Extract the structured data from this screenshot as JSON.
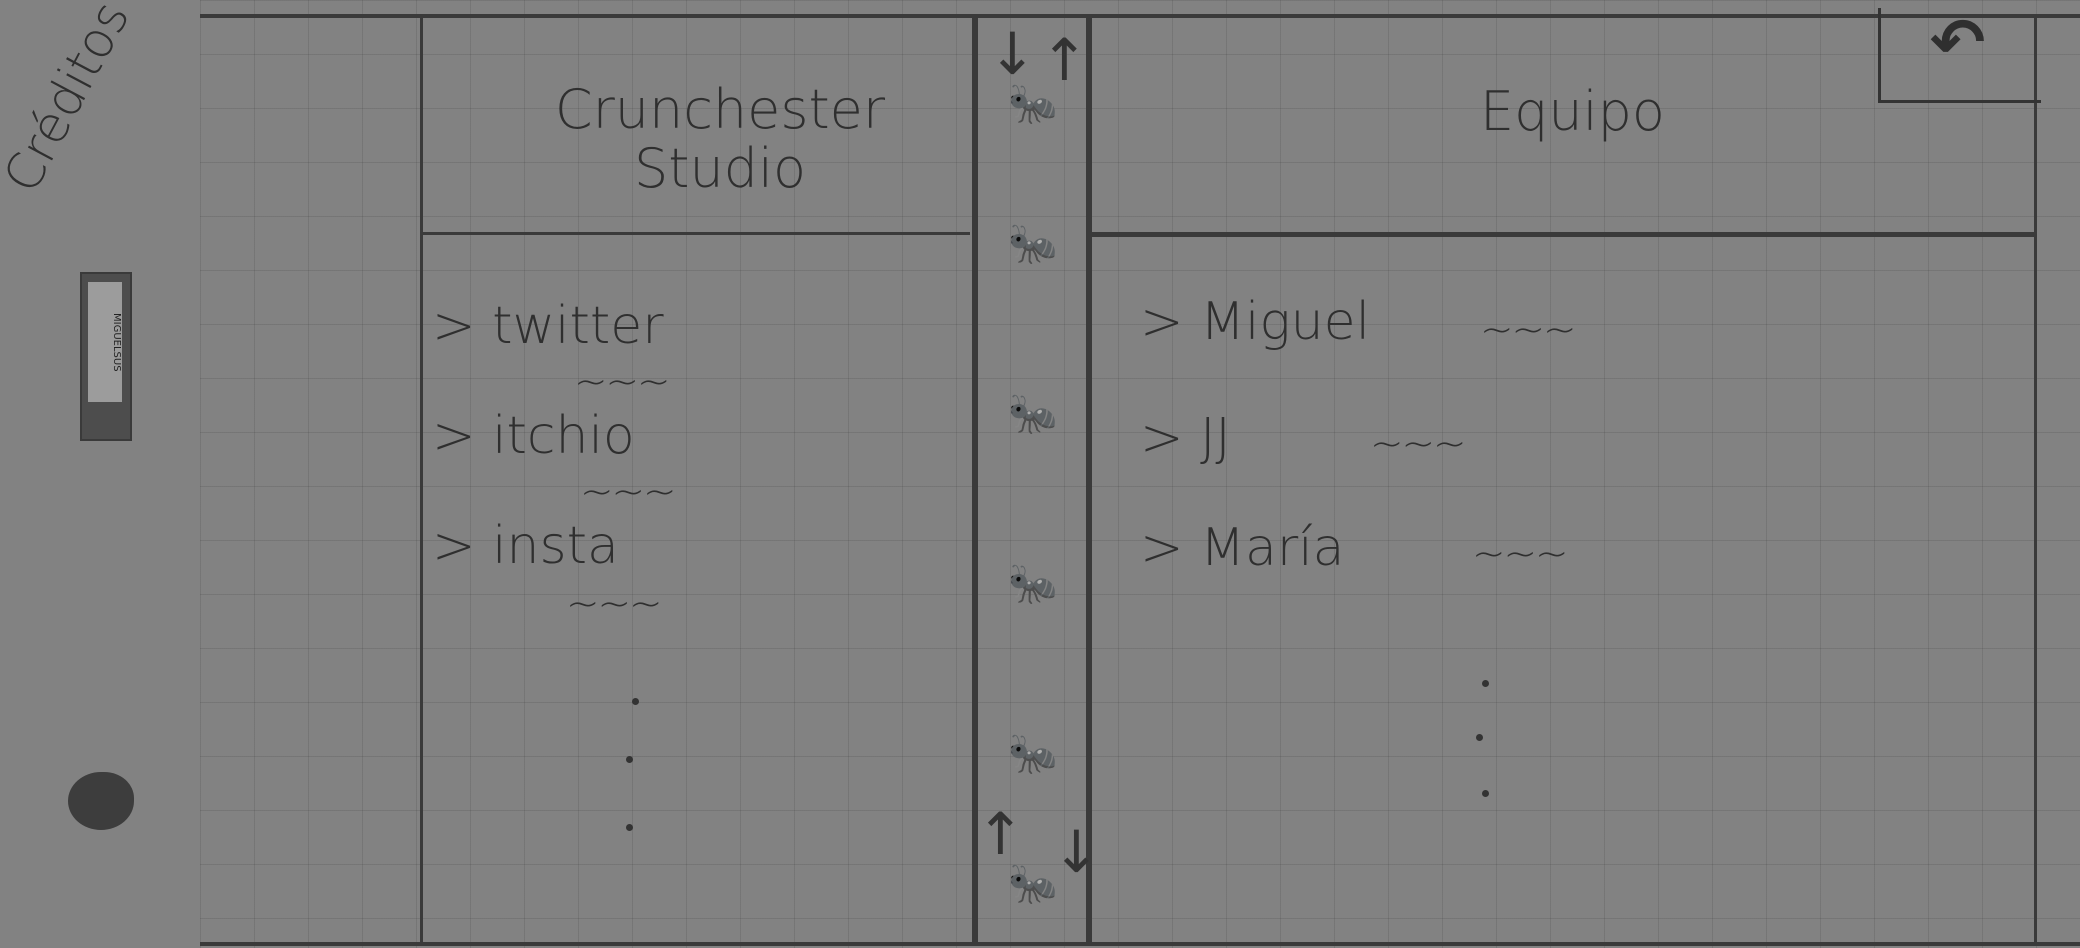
{
  "sidebar": {
    "heading": "Créditos",
    "sticker_text": "MIGUELSUS",
    "logo_icon": "flame-logo"
  },
  "left_panel": {
    "title": "Crunchester Studio",
    "items": [
      {
        "label": "> twitter",
        "detail": "~~~"
      },
      {
        "label": "> itchio",
        "detail": "~~~"
      },
      {
        "label": "> insta",
        "detail": "~~~"
      }
    ]
  },
  "right_panel": {
    "title": "Equipo",
    "items": [
      {
        "label": "> Miguel",
        "detail": "~~~"
      },
      {
        "label": "> JJ",
        "detail": "~~~"
      },
      {
        "label": "> María",
        "detail": "~~~"
      }
    ],
    "corner_icon": "back-arrow-icon"
  },
  "middle_column": {
    "icon": "ant-icon"
  }
}
